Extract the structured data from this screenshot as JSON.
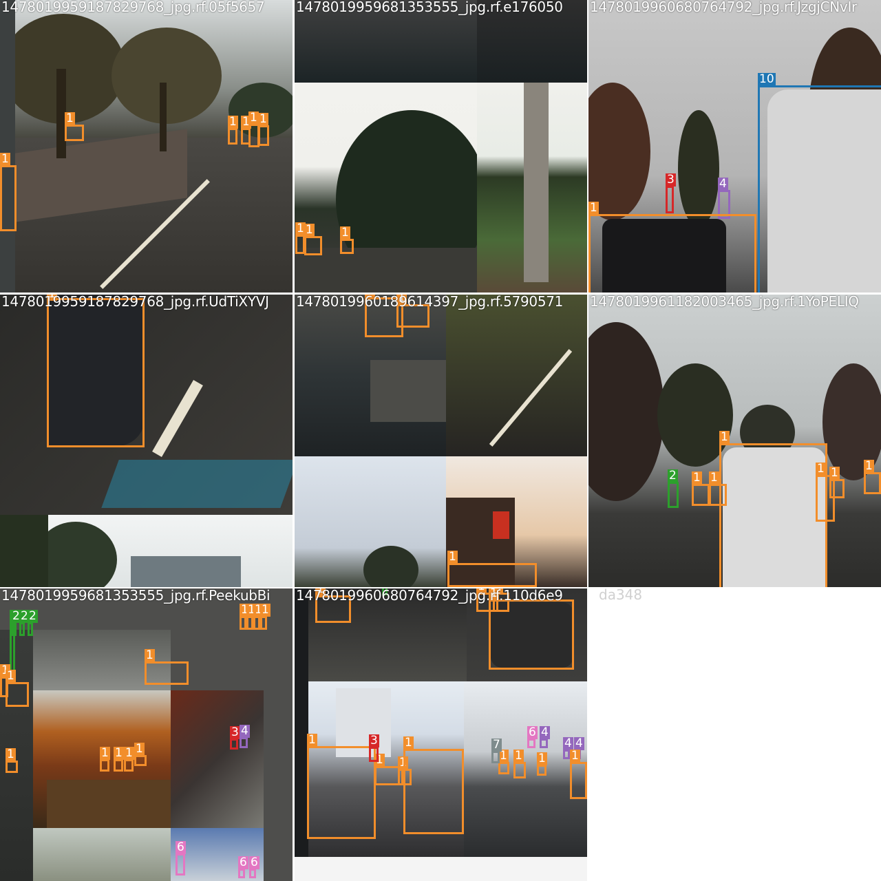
{
  "tiles": [
    {
      "filename": "1478019959187829768_jpg.rf.05f5657"
    },
    {
      "filename": "1478019959681353555_jpg.rf.e176050"
    },
    {
      "filename": "1478019960680764792_jpg.rf.JzgjCNvIr"
    },
    {
      "filename": "1478019959187829768_jpg.rf.UdTiXYVJ"
    },
    {
      "filename": "1478019960189614397_jpg.rf.5790571"
    },
    {
      "filename": "1478019961182003465_jpg.rf.1YoPELIQ"
    },
    {
      "filename": "1478019959681353555_jpg.rf.PeekubBi"
    },
    {
      "filename": "1478019960680764792_jpg.rf.110d6e9"
    }
  ],
  "overflow_text": "da348",
  "class_colors": {
    "1": "#f28e2b",
    "2": "#2ca02c",
    "3": "#d62728",
    "4": "#9467bd",
    "6": "#e377c2",
    "7": "#7f8c8d",
    "10": "#1f77b4"
  },
  "labels": {
    "t0": [
      "1",
      "1",
      "1",
      "1",
      "1",
      "1",
      "1"
    ],
    "t1": [
      "1",
      "1",
      "1"
    ],
    "t2": [
      "10",
      "3",
      "4",
      "1"
    ],
    "t3": [
      "1"
    ],
    "t4": [
      "1",
      "1",
      "1"
    ],
    "t5": [
      "1",
      "2",
      "1",
      "1",
      "1",
      "1",
      "1"
    ],
    "t6": [
      "2",
      "2",
      "2",
      "2",
      "1",
      "1",
      "1",
      "1",
      "1",
      "1",
      "1",
      "1",
      "1",
      "1",
      "1",
      "1",
      "3",
      "4",
      "6",
      "6",
      "6"
    ],
    "t7": [
      "1",
      "1",
      "1",
      "1",
      "1",
      "1",
      "3",
      "1",
      "1",
      "1",
      "1",
      "7",
      "6",
      "4",
      "4",
      "4",
      "1",
      "1",
      "2"
    ]
  }
}
